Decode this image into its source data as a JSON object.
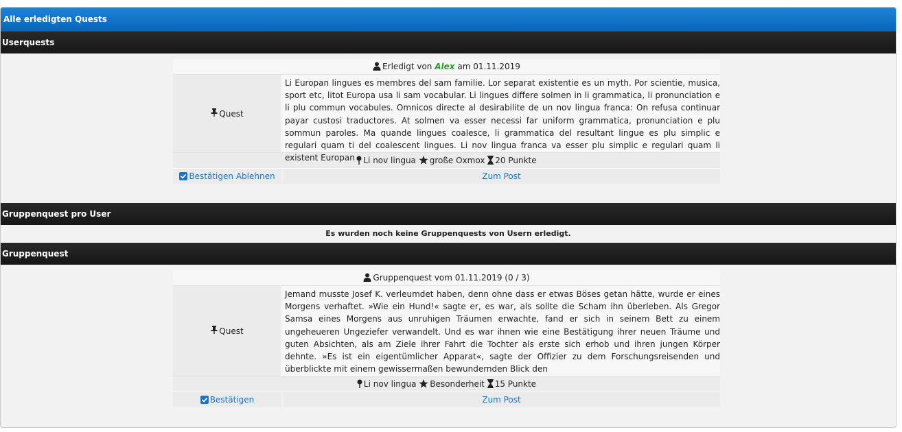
{
  "panel": {
    "title": "Alle erledigten Quests"
  },
  "userquests": {
    "section_title": "Userquests",
    "done_prefix": "Erledigt von",
    "user": "Alex",
    "date_text": "am 01.11.2019",
    "type_label": "Quest",
    "text": "Li Europan lingues es membres del sam familie. Lor separat existentie es un myth. Por scientie, musica, sport etc, litot Europa usa li sam vocabular. Li lingues differe solmen in li grammatica, li pronunciation e li plu commun vocabules. Omnicos directe al desirabilite de un nov lingua franca: On refusa continuar payar custosi traductores. At solmen va esser necessi far uniform grammatica, pronunciation e plu sommun paroles. Ma quande lingues coalesce, li grammatica del resultant lingue es plu simplic e regulari quam ti del coalescent lingues. Li nov lingua franca va esser plu simplic e regulari quam li existent Europan",
    "location": "Li nov lingua",
    "reward": "große Oxmox",
    "points": "20 Punkte",
    "confirm_label": "Bestätigen",
    "reject_label": "Ablehnen",
    "post_link": "Zum Post"
  },
  "groupquest_per_user": {
    "section_title": "Gruppenquest pro User",
    "empty_notice": "Es wurden noch keine Gruppenquests von Usern erledigt."
  },
  "groupquest": {
    "section_title": "Gruppenquest",
    "header_text": "Gruppenquest vom 01.11.2019 (0 / 3)",
    "type_label": "Quest",
    "text": "Jemand musste Josef K. verleumdet haben, denn ohne dass er etwas Böses getan hätte, wurde er eines Morgens verhaftet. »Wie ein Hund!« sagte er, es war, als sollte die Scham ihn überleben. Als Gregor Samsa eines Morgens aus unruhigen Träumen erwachte, fand er sich in seinem Bett zu einem ungeheueren Ungeziefer verwandelt. Und es war ihnen wie eine Bestätigung ihrer neuen Träume und guten Absichten, als am Ziele ihrer Fahrt die Tochter als erste sich erhob und ihren jungen Körper dehnte. »Es ist ein eigentümlicher Apparat«, sagte der Offizier zu dem Forschungsreisenden und überblickte mit einem gewissermaßen bewundernden Blick den",
    "location": "Li nov lingua",
    "reward": "Besonderheit",
    "points": "15 Punkte",
    "confirm_label": "Bestätigen",
    "post_link": "Zum Post"
  },
  "colors": {
    "title_bar": "#0a66b8",
    "section_bar": "#1e1e1e",
    "link": "#1a73c9",
    "username": "#2e9b2e"
  },
  "icons": [
    "user-icon",
    "pin-icon",
    "map-marker-icon",
    "star-icon",
    "hourglass-icon",
    "checkbox-icon"
  ]
}
